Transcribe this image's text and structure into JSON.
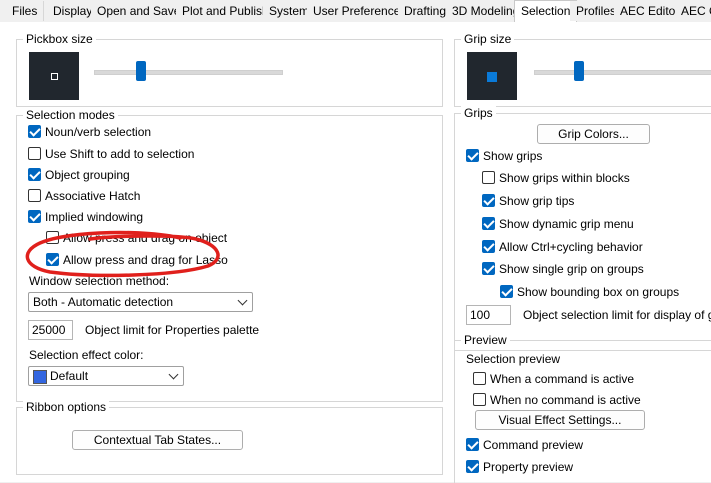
{
  "tabs": [
    "Files",
    "Display",
    "Open and Save",
    "Plot and Publish",
    "System",
    "User Preferences",
    "Drafting",
    "3D Modeling",
    "Selection",
    "Profiles",
    "AEC Editor",
    "AEC O"
  ],
  "active_tab": "Selection",
  "left": {
    "pickbox": {
      "title": "Pickbox size",
      "level": 0.25
    },
    "selection_modes": {
      "title": "Selection modes",
      "items": [
        {
          "label": "Noun/verb selection",
          "checked": true
        },
        {
          "label": "Use Shift to add to selection",
          "checked": false
        },
        {
          "label": "Object grouping",
          "checked": true
        },
        {
          "label": "Associative Hatch",
          "checked": false
        },
        {
          "label": "Implied windowing",
          "checked": true
        },
        {
          "label": "Allow press and drag on object",
          "checked": false
        },
        {
          "label": "Allow press and drag for Lasso",
          "checked": true
        }
      ],
      "window_method_label": "Window selection method:",
      "window_method_value": "Both - Automatic detection",
      "object_limit_value": "25000",
      "object_limit_label": "Object limit for Properties palette",
      "effect_color_label": "Selection effect color:",
      "effect_color_value": "Default",
      "effect_color_swatch": "#3366e0"
    },
    "ribbon": {
      "title": "Ribbon options",
      "button_label": "Contextual Tab States..."
    }
  },
  "right": {
    "grip_size": {
      "title": "Grip size",
      "level": 0.25
    },
    "grips": {
      "title": "Grips",
      "colors_button": "Grip Colors...",
      "items": [
        {
          "label": "Show grips",
          "checked": true
        },
        {
          "label": "Show grips within blocks",
          "checked": false
        },
        {
          "label": "Show grip tips",
          "checked": true
        },
        {
          "label": "Show dynamic grip menu",
          "checked": true
        },
        {
          "label": "Allow Ctrl+cycling behavior",
          "checked": true
        },
        {
          "label": "Show single grip on groups",
          "checked": true
        },
        {
          "label": "Show bounding box on groups",
          "checked": true
        }
      ],
      "limit_value": "100",
      "limit_label": "Object selection limit for display of grips"
    },
    "preview": {
      "title": "Preview",
      "sub_title": "Selection preview",
      "items": [
        {
          "label": "When a command is active",
          "checked": false
        },
        {
          "label": "When no command is active",
          "checked": false
        }
      ],
      "visual_effect_button": "Visual Effect Settings...",
      "bottom_items": [
        {
          "label": "Command preview",
          "checked": true
        },
        {
          "label": "Property preview",
          "checked": true
        }
      ]
    }
  },
  "colors": {
    "accent": "#0067c0",
    "annotation": "#e0201c",
    "preview_bg": "#21272e"
  }
}
